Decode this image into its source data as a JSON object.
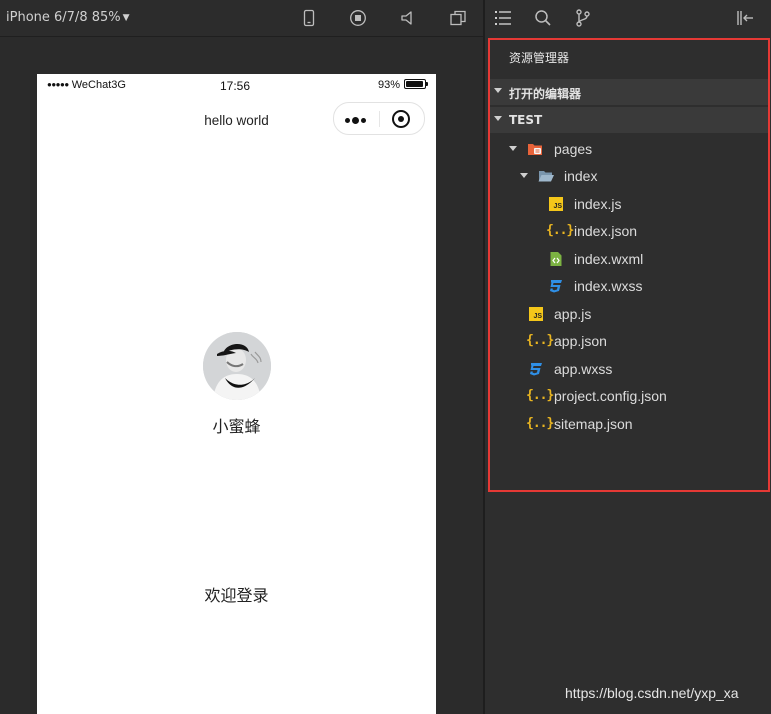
{
  "simulator": {
    "device_label": "iPhone 6/7/8 85%",
    "toolbar_icons": [
      "phone-icon",
      "record-icon",
      "volume-icon",
      "windows-icon"
    ]
  },
  "phone": {
    "statusbar": {
      "signal": "WeChat3G",
      "time": "17:56",
      "battery": "93%"
    },
    "nav_title": "hello world",
    "nickname": "小蜜蜂",
    "welcome": "欢迎登录"
  },
  "explorer": {
    "toolbar_icons": [
      "list-icon",
      "search-icon",
      "branch-icon",
      "collapse-panel-icon"
    ],
    "panel_title": "资源管理器",
    "sections": {
      "open_editors": "打开的编辑器",
      "project": "TEST"
    },
    "tree": [
      {
        "name": "pages",
        "icon": "folder-pages-icon"
      },
      {
        "name": "index",
        "icon": "folder-open-icon"
      },
      {
        "name": "index.js",
        "icon": "js-file-icon"
      },
      {
        "name": "index.json",
        "icon": "json-file-icon"
      },
      {
        "name": "index.wxml",
        "icon": "wxml-file-icon"
      },
      {
        "name": "index.wxss",
        "icon": "wxss-file-icon"
      },
      {
        "name": "app.js",
        "icon": "js-file-icon"
      },
      {
        "name": "app.json",
        "icon": "json-file-icon"
      },
      {
        "name": "app.wxss",
        "icon": "wxss-file-icon"
      },
      {
        "name": "project.config.json",
        "icon": "json-file-icon"
      },
      {
        "name": "sitemap.json",
        "icon": "json-file-icon"
      }
    ],
    "highlight_color": "#e53935"
  },
  "watermark": "https://blog.csdn.net/yxp_xa"
}
